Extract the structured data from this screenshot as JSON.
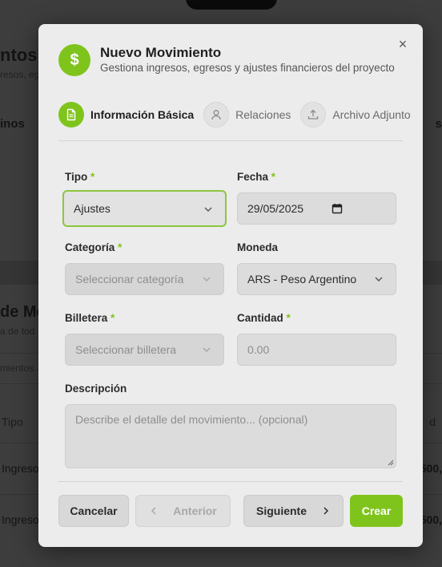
{
  "background": {
    "title": "ntos",
    "subtitle": "resos, eg",
    "tab_left": "inos",
    "tab_right": "s",
    "section_title": "de Mo",
    "section_sub": "a de tod",
    "filter_placeholder": "mientos...",
    "col_tipo": "Tipo",
    "col_right": "d",
    "row1_tipo": "Ingreso",
    "row1_amount": "500,",
    "row2_tipo": "Ingreso",
    "row2_amount": "500,"
  },
  "modal": {
    "title": "Nuevo Movimiento",
    "subtitle": "Gestiona ingresos, egresos y ajustes financieros del proyecto",
    "header_icon": "dollar-icon",
    "close_glyph": "×",
    "steps": [
      {
        "label": "Información Básica",
        "icon": "document-icon",
        "active": true
      },
      {
        "label": "Relaciones",
        "icon": "person-icon",
        "active": false
      },
      {
        "label": "Archivo Adjunto",
        "icon": "upload-icon",
        "active": false
      }
    ],
    "fields": {
      "tipo": {
        "label": "Tipo",
        "required": "*",
        "value": "Ajustes"
      },
      "fecha": {
        "label": "Fecha",
        "required": "*",
        "value": "29/05/2025"
      },
      "categoria": {
        "label": "Categoría",
        "required": "*",
        "placeholder": "Seleccionar categoría"
      },
      "moneda": {
        "label": "Moneda",
        "value": "ARS - Peso Argentino"
      },
      "billetera": {
        "label": "Billetera",
        "required": "*",
        "placeholder": "Seleccionar billetera"
      },
      "cantidad": {
        "label": "Cantidad",
        "required": "*",
        "placeholder": "0.00"
      },
      "descripcion": {
        "label": "Descripción",
        "placeholder": "Describe el detalle del movimiento... (opcional)"
      }
    },
    "buttons": {
      "cancel": "Cancelar",
      "prev": "Anterior",
      "next": "Siguiente",
      "create": "Crear"
    },
    "colors": {
      "accent": "#7fc41c",
      "modal_bg": "#ececec",
      "overlay": "#3c3c3c"
    }
  }
}
